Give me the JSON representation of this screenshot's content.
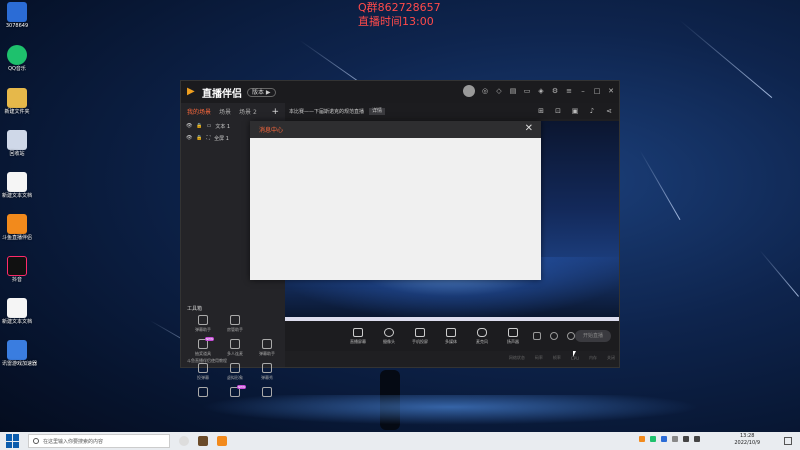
{
  "desktop": {
    "icons": [
      {
        "label": "3078649",
        "color": "#2b6cd6"
      },
      {
        "label": "QQ音乐",
        "color": "#1ec16d"
      },
      {
        "label": "新建文件夹",
        "color": "#e6b84a"
      },
      {
        "label": "回收站",
        "color": "#cfd8e8"
      },
      {
        "label": "新建文本文档",
        "color": "#f5f5f5"
      },
      {
        "label": "斗鱼直播伴侣",
        "color": "#f28a1c"
      },
      {
        "label": "抖音",
        "color": "#111111"
      },
      {
        "label": "新建文本文档",
        "color": "#f5f5f5"
      },
      {
        "label": "讯雷游戏加速器",
        "color": "#3a7de0"
      }
    ],
    "overlay_line1": "Q群862728657",
    "overlay_line2": "直播时间13:00"
  },
  "app": {
    "name": "直播伴侣",
    "version_pill": "版本 ▶",
    "scene_tabs": [
      "我的场景",
      "场景",
      "场景 2"
    ],
    "sources": [
      {
        "label": "文本 1"
      },
      {
        "label": "全屏 1"
      }
    ],
    "tools_title": "工具箱",
    "tools": [
      {
        "label": "弹幕助手"
      },
      {
        "label": "房管助手"
      },
      {
        "label": ""
      },
      {
        "label": "抽奖道具",
        "badge": "NEW"
      },
      {
        "label": "多人连麦"
      },
      {
        "label": "弹幕助手"
      },
      {
        "label": "投弹幕"
      },
      {
        "label": "虚拟形象"
      },
      {
        "label": "弹幕秀"
      },
      {
        "label": ""
      },
      {
        "label": "",
        "badge": "NEW"
      },
      {
        "label": ""
      }
    ],
    "left_footer": "斗鱼直播伴侣使用教程",
    "notice": "本比赛——下届斯诺克的规范直播",
    "notice_button": "详情",
    "bottom_bar": [
      {
        "label": "直播屏幕"
      },
      {
        "label": "摄像头"
      },
      {
        "label": "手机投屏"
      },
      {
        "label": "多媒体"
      },
      {
        "label": "麦克风"
      },
      {
        "label": "扬声器"
      }
    ],
    "start_button": "开始直播",
    "status": [
      "网络状态",
      "码率",
      "帧率",
      "CPU",
      "内存",
      "关闭"
    ]
  },
  "dialog": {
    "title": "消息中心",
    "close": "✕"
  },
  "taskbar": {
    "search_placeholder": "在这里输入你要搜索的内容",
    "time": "13:28",
    "date": "2022/10/9"
  },
  "colors": {
    "accent": "#ff6a3d",
    "overlay_text": "#ff4a4a"
  }
}
